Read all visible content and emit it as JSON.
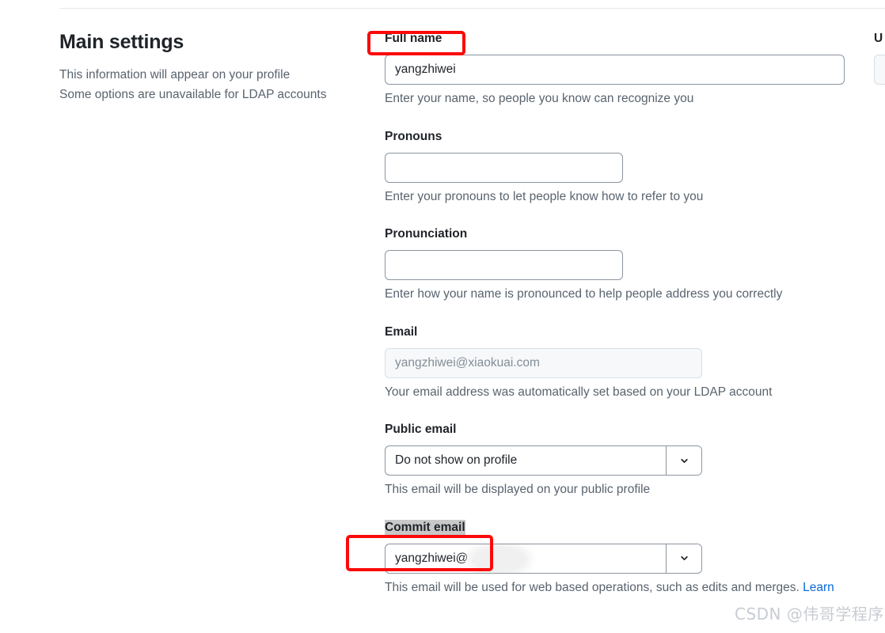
{
  "section": {
    "title": "Main settings",
    "description_line1": "This information will appear on your profile",
    "description_line2": "Some options are unavailable for LDAP accounts"
  },
  "form": {
    "full_name": {
      "label": "Full name",
      "value": "yangzhiwei",
      "hint": "Enter your name, so people you know can recognize you"
    },
    "pronouns": {
      "label": "Pronouns",
      "value": "",
      "hint": "Enter your pronouns to let people know how to refer to you"
    },
    "pronunciation": {
      "label": "Pronunciation",
      "value": "",
      "hint": "Enter how your name is pronounced to help people address you correctly"
    },
    "email": {
      "label": "Email",
      "value": "yangzhiwei@xiaokuai.com",
      "hint": "Your email address was automatically set based on your LDAP account"
    },
    "public_email": {
      "label": "Public email",
      "selected": "Do not show on profile",
      "hint": "This email will be displayed on your public profile",
      "chevron_icon": "chevron-down-icon"
    },
    "commit_email": {
      "label": "Commit email",
      "selected": "yangzhiwei@               .com",
      "hint_text": "This email will be used for web based operations, such as edits and merges. ",
      "hint_link": "Learn",
      "chevron_icon": "chevron-down-icon"
    }
  },
  "cut_off_column": {
    "label": "U"
  },
  "annotations": {
    "color": "#fb0a0a",
    "boxes": [
      "full-name-label",
      "commit-email-label"
    ]
  },
  "watermark": {
    "text": "CSDN @伟哥学程序"
  }
}
